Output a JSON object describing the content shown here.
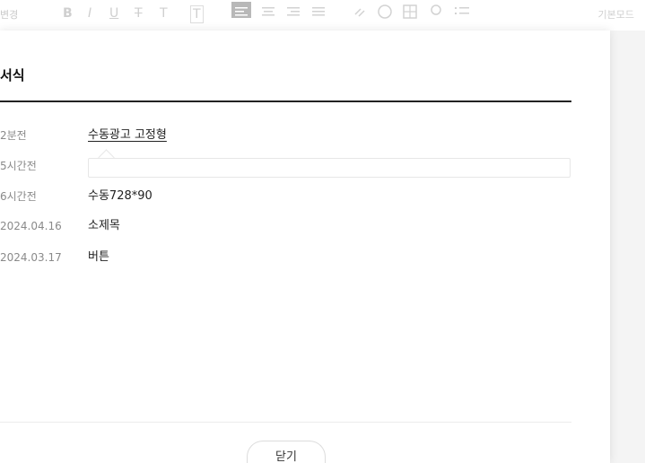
{
  "toolbar": {
    "left_text": "변경",
    "bold_label": "B",
    "italic_label": "I",
    "underline_label": "U",
    "strike_label": "T",
    "text_label": "T",
    "font_size_label": "T",
    "right_text": "기본모드"
  },
  "panel": {
    "title": "서식",
    "rows": [
      {
        "date": "2분전",
        "name": "수동광고 고정형"
      },
      {
        "date": "5시간전",
        "name": ""
      },
      {
        "date": "6시간전",
        "name": "수동728*90"
      },
      {
        "date": "2024.04.16",
        "name": "소제목"
      },
      {
        "date": "2024.03.17",
        "name": "버튼"
      }
    ],
    "close_label": "닫기"
  }
}
